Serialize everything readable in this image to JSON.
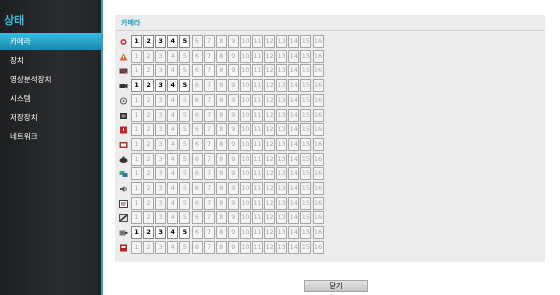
{
  "sidebar": {
    "title": "상태",
    "items": [
      {
        "label": "카메라",
        "active": true
      },
      {
        "label": "장치",
        "active": false
      },
      {
        "label": "영상분석장치",
        "active": false
      },
      {
        "label": "시스템",
        "active": false
      },
      {
        "label": "저장장치",
        "active": false
      },
      {
        "label": "네트워크",
        "active": false
      }
    ]
  },
  "panel": {
    "title": "카메라",
    "channels": [
      "1",
      "2",
      "3",
      "4",
      "5",
      "6",
      "7",
      "8",
      "9",
      "10",
      "11",
      "12",
      "13",
      "14",
      "15",
      "16"
    ],
    "rows": [
      {
        "icon": "record-status-icon",
        "active": [
          1,
          2,
          3,
          4,
          5
        ]
      },
      {
        "icon": "alarm-status-icon",
        "active": []
      },
      {
        "icon": "video-loss-icon",
        "active": []
      },
      {
        "icon": "camera-status-icon",
        "active": [
          1,
          2,
          3,
          4,
          5
        ]
      },
      {
        "icon": "motion-icon",
        "active": []
      },
      {
        "icon": "video-analysis-icon",
        "active": []
      },
      {
        "icon": "event-alert-icon",
        "active": []
      },
      {
        "icon": "tamper-icon",
        "active": []
      },
      {
        "icon": "ptz-icon",
        "active": []
      },
      {
        "icon": "privacy-icon",
        "active": []
      },
      {
        "icon": "audio-icon",
        "active": []
      },
      {
        "icon": "text-event-icon",
        "active": []
      },
      {
        "icon": "trip-zone-icon",
        "active": []
      },
      {
        "icon": "network-camera-icon",
        "active": [
          1,
          2,
          3,
          4,
          5
        ]
      },
      {
        "icon": "disk-icon",
        "active": []
      }
    ]
  },
  "footer": {
    "close_label": "닫기"
  },
  "colors": {
    "accent": "#2ea7c7",
    "sidebar_bg": "#232527",
    "panel_bg": "#ececec"
  }
}
